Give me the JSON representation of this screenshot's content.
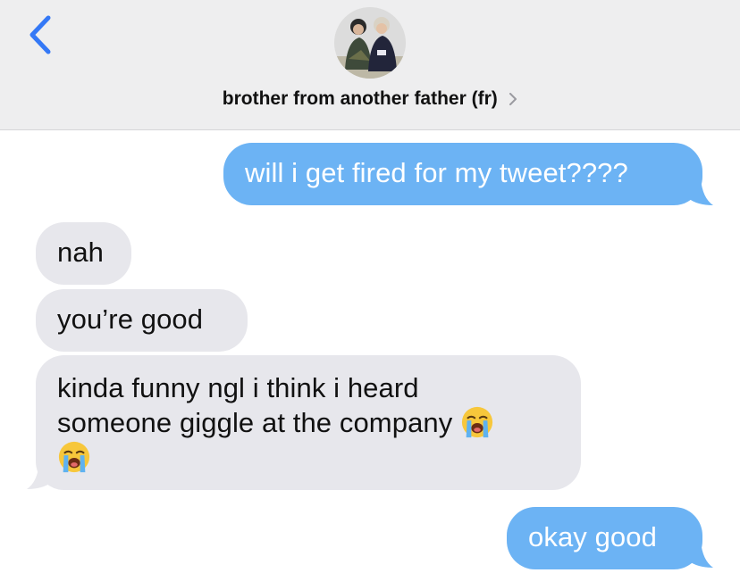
{
  "header": {
    "contact_name": "brother from another father (fr)",
    "back_icon": "chevron-left-icon",
    "detail_icon": "chevron-right-icon",
    "accent_color": "#3478f6"
  },
  "messages": [
    {
      "direction": "sent",
      "text": "will i get fired for my tweet????"
    },
    {
      "direction": "received",
      "text": "nah"
    },
    {
      "direction": "received",
      "text": "you’re good"
    },
    {
      "direction": "received",
      "line1": "kinda funny ngl i think i heard",
      "line2": "someone giggle at the company",
      "emoji": "loudly-crying-face-icon"
    },
    {
      "direction": "sent",
      "text": "okay good"
    }
  ],
  "colors": {
    "sent_bubble": "#6cb3f4",
    "received_bubble": "#e7e7ec",
    "header_bg": "#eeeeef"
  }
}
